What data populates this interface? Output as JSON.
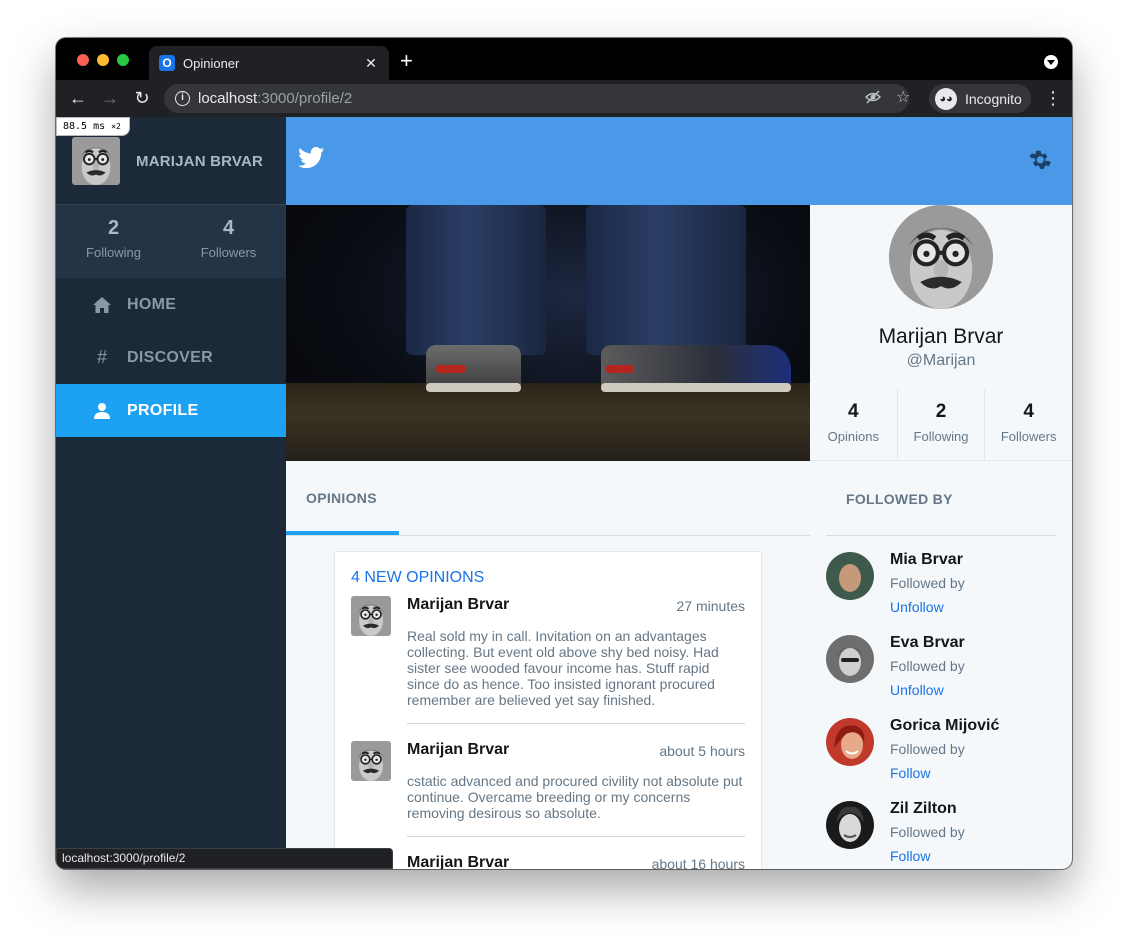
{
  "browser": {
    "tab_title": "Opinioner",
    "tab_favicon": "O",
    "url_host": "localhost",
    "url_path": ":3000/profile/2",
    "incognito_label": "Incognito",
    "status_url": "localhost:3000/profile/2",
    "perf_badge": "88.5 ms",
    "perf_multiplier": "×2",
    "icons": [
      "back-arrow-icon",
      "forward-arrow-icon",
      "reload-icon",
      "info-icon",
      "eye-off-icon",
      "star-icon",
      "incognito-icon",
      "kebab-menu-icon"
    ]
  },
  "sidebar": {
    "user_name": "MARIJAN BRVAR",
    "stats": [
      {
        "value": "2",
        "label": "Following"
      },
      {
        "value": "4",
        "label": "Followers"
      }
    ],
    "nav": [
      {
        "label": "HOME",
        "icon": "home-icon"
      },
      {
        "label": "DISCOVER",
        "icon": "hash-icon"
      },
      {
        "label": "PROFILE",
        "icon": "user-icon",
        "active": true
      }
    ]
  },
  "header": {
    "logo_icon": "twitter-bird-icon",
    "settings_icon": "gear-icon",
    "background_color": "#4a99e9"
  },
  "profile": {
    "name": "Marijan Brvar",
    "handle": "@Marijan",
    "stats": [
      {
        "value": "4",
        "label": "Opinions"
      },
      {
        "value": "2",
        "label": "Following"
      },
      {
        "value": "4",
        "label": "Followers"
      }
    ]
  },
  "opinions": {
    "tab_label": "OPINIONS",
    "new_label": "4 NEW OPINIONS",
    "items": [
      {
        "author": "Marijan Brvar",
        "time": "27 minutes",
        "text": "Real sold my in call. Invitation on an advantages collecting. But event old above shy bed noisy. Had sister see wooded favour income has. Stuff rapid since do as hence. Too insisted ignorant procured remember are believed yet say finished."
      },
      {
        "author": "Marijan Brvar",
        "time": "about 5 hours",
        "text": "cstatic advanced and procured civility not absolute put continue. Overcame breeding or my concerns removing desirous so absolute."
      },
      {
        "author": "Marijan Brvar",
        "time": "about 16 hours",
        "text": ""
      }
    ]
  },
  "followed_by": {
    "title": "FOLLOWED BY",
    "items": [
      {
        "name": "Mia Brvar",
        "sub": "Followed by",
        "action": "Unfollow"
      },
      {
        "name": "Eva Brvar",
        "sub": "Followed by",
        "action": "Unfollow"
      },
      {
        "name": "Gorica Mijović",
        "sub": "Followed by",
        "action": "Follow"
      },
      {
        "name": "Zil Zilton",
        "sub": "Followed by",
        "action": "Follow"
      }
    ]
  },
  "colors": {
    "accent": "#1da1f2",
    "link": "#1a73e8",
    "sidebar": "#1c2938"
  }
}
